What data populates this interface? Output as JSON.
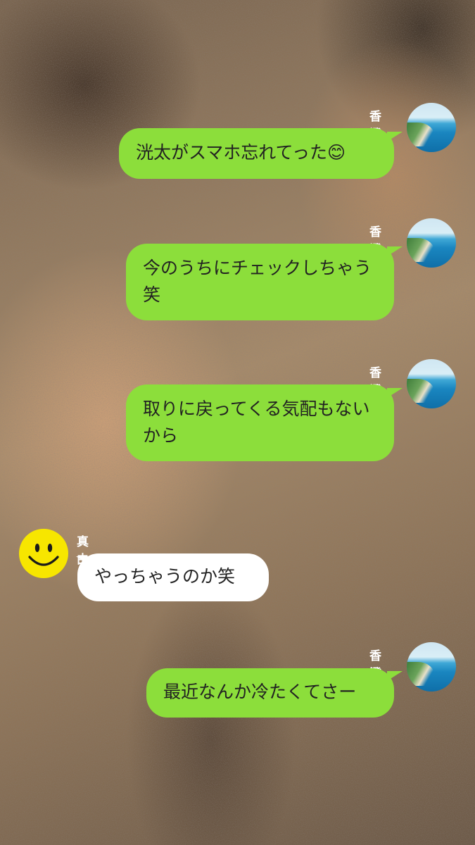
{
  "chat": {
    "messages": [
      {
        "sender": "香澄",
        "text": "洸太がスマホ忘れてった",
        "emoji": "😊",
        "side": "right"
      },
      {
        "sender": "香澄",
        "text": "今のうちにチェックしちゃう笑",
        "side": "right"
      },
      {
        "sender": "香澄",
        "text": "取りに戻ってくる気配もないから",
        "side": "right"
      },
      {
        "sender": "真由",
        "text": "やっちゃうのか笑",
        "side": "left"
      },
      {
        "sender": "香澄",
        "text": "最近なんか冷たくてさー",
        "side": "right"
      }
    ]
  },
  "avatars": {
    "kasumi": "beach-sea-avatar",
    "mayu": "smiley-face-avatar"
  },
  "colors": {
    "outgoing_bubble": "#8cde3b",
    "incoming_bubble": "#ffffff",
    "smiley": "#f7e600"
  }
}
